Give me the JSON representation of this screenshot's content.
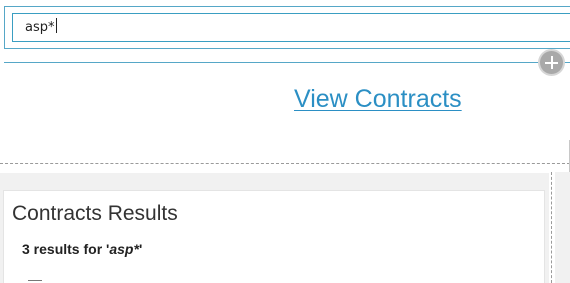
{
  "search": {
    "value": "asp*"
  },
  "view_contracts_link": "View Contracts",
  "results": {
    "title": "Contracts Results",
    "count_prefix": "3 results for '",
    "query": "asp*",
    "count_suffix": "'"
  },
  "icons": {
    "add": "plus-circle-icon"
  },
  "colors": {
    "accent": "#2b8fc4",
    "border": "#56a7c7"
  }
}
